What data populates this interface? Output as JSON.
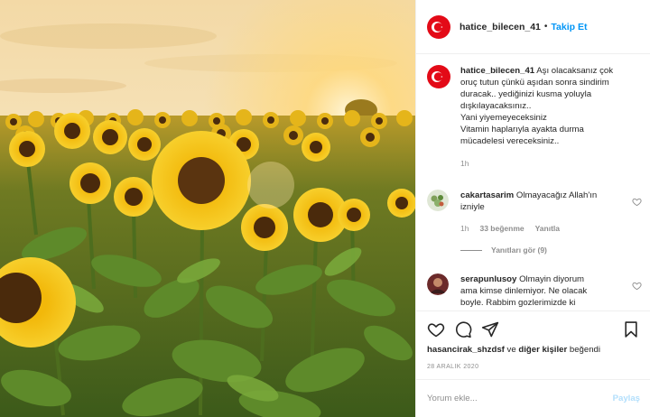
{
  "post": {
    "author": "hatice_bilecen_41",
    "separator": "•",
    "follow_label": "Takip Et"
  },
  "caption": {
    "author": "hatice_bilecen_41",
    "lines": [
      "Aşı olacaksanız çok",
      "oruç tutun çünkü aşıdan sonra sindirim",
      "duracak.. yediğinizi kusma yoluyla",
      "dışkılayacaksınız..",
      "Yani yiyemeyeceksiniz",
      "Vitamin haplarıyla ayakta durma",
      "mücadelesi vereceksiniz.."
    ],
    "time": "1h"
  },
  "comments": [
    {
      "author": "cakartasarim",
      "text_line1": "Olmayacağız Allah'ın",
      "text_line2": "izniyle",
      "time": "1h",
      "likes": "33 beğenme",
      "reply": "Yanıtla",
      "view_replies": "Yanıtları gör (9)"
    },
    {
      "author": "serapunlusoy",
      "text_line1": "Olmayin diyorum",
      "text_line2": "ama kimse dinlemiyor. Ne olacak",
      "text_line3": "boyle. Rabbim gozlerimizde ki"
    }
  ],
  "likes": {
    "user": "hasancirak_shzdsf",
    "connector": "ve",
    "others": "diğer kişiler",
    "suffix": "beğendi"
  },
  "date": "28 ARALIK 2020",
  "add_comment": {
    "placeholder": "Yorum ekle...",
    "post_label": "Paylaş"
  },
  "icons": {
    "avatar": "turkish-flag-avatar",
    "like": "heart-icon",
    "comment": "comment-bubble-icon",
    "share": "paper-plane-icon",
    "save": "bookmark-icon"
  },
  "colors": {
    "link": "#0095f6",
    "muted": "#8e8e8e",
    "flag_red": "#e30a17",
    "post_disabled": "#b2dffc"
  }
}
